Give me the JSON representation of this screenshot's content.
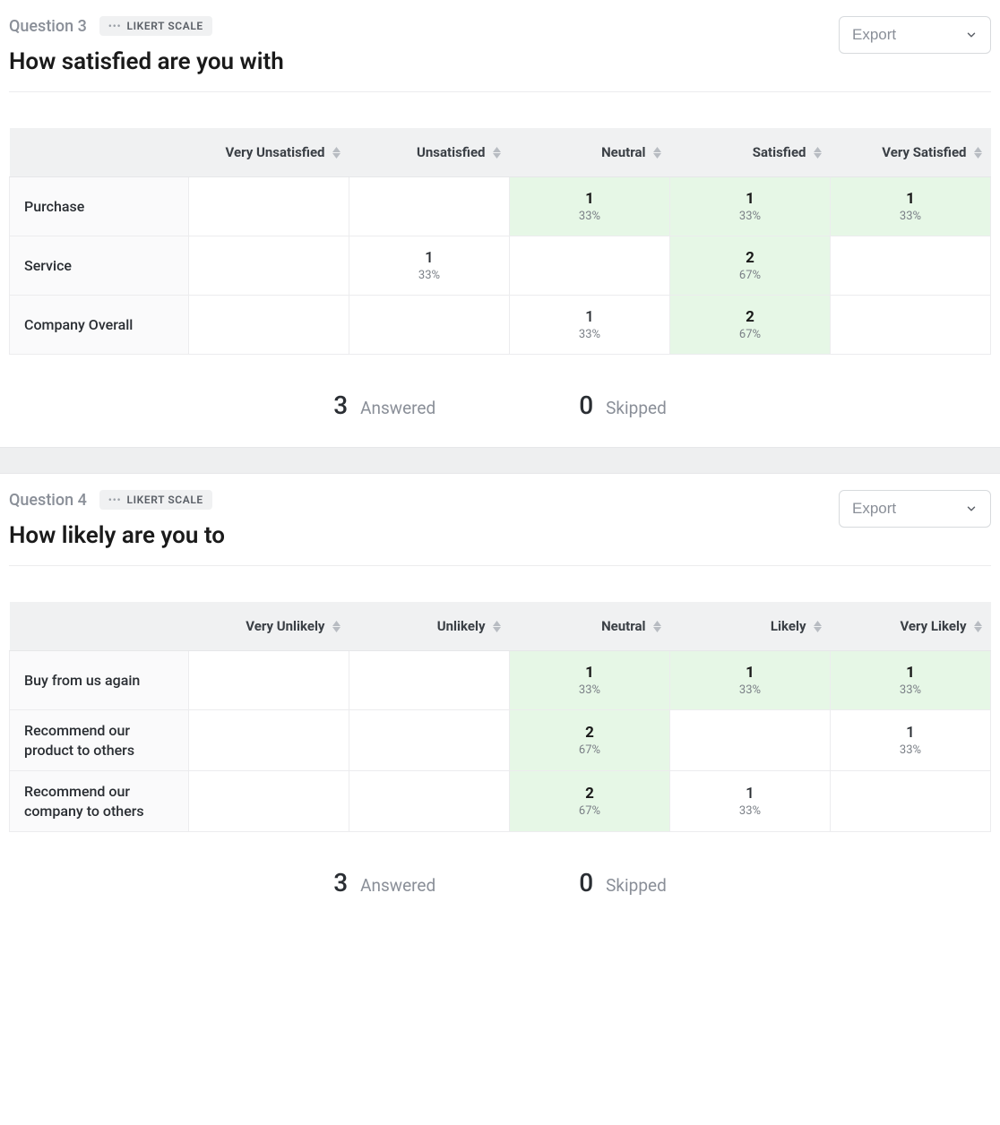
{
  "export_label": "Export",
  "answered_label": "Answered",
  "skipped_label": "Skipped",
  "questions": [
    {
      "number": "Question 3",
      "type_label": "LIKERT SCALE",
      "title": "How satisfied are you with",
      "columns": [
        "Very Unsatisfied",
        "Unsatisfied",
        "Neutral",
        "Satisfied",
        "Very Satisfied"
      ],
      "rows": [
        {
          "label": "Purchase",
          "cells": [
            null,
            null,
            {
              "count": "1",
              "pct": "33%",
              "highlight": true
            },
            {
              "count": "1",
              "pct": "33%",
              "highlight": true
            },
            {
              "count": "1",
              "pct": "33%",
              "highlight": true
            }
          ]
        },
        {
          "label": "Service",
          "cells": [
            null,
            {
              "count": "1",
              "pct": "33%",
              "highlight": false
            },
            null,
            {
              "count": "2",
              "pct": "67%",
              "highlight": true
            },
            null
          ]
        },
        {
          "label": "Company Overall",
          "cells": [
            null,
            null,
            {
              "count": "1",
              "pct": "33%",
              "highlight": false
            },
            {
              "count": "2",
              "pct": "67%",
              "highlight": true
            },
            null
          ]
        }
      ],
      "answered": "3",
      "skipped": "0"
    },
    {
      "number": "Question 4",
      "type_label": "LIKERT SCALE",
      "title": "How likely are you to",
      "columns": [
        "Very Unlikely",
        "Unlikely",
        "Neutral",
        "Likely",
        "Very Likely"
      ],
      "rows": [
        {
          "label": "Buy from us again",
          "cells": [
            null,
            null,
            {
              "count": "1",
              "pct": "33%",
              "highlight": true
            },
            {
              "count": "1",
              "pct": "33%",
              "highlight": true
            },
            {
              "count": "1",
              "pct": "33%",
              "highlight": true
            }
          ]
        },
        {
          "label": "Recommend our product to others",
          "cells": [
            null,
            null,
            {
              "count": "2",
              "pct": "67%",
              "highlight": true
            },
            null,
            {
              "count": "1",
              "pct": "33%",
              "highlight": false
            }
          ]
        },
        {
          "label": "Recommend our company to others",
          "cells": [
            null,
            null,
            {
              "count": "2",
              "pct": "67%",
              "highlight": true
            },
            {
              "count": "1",
              "pct": "33%",
              "highlight": false
            },
            null
          ]
        }
      ],
      "answered": "3",
      "skipped": "0"
    }
  ],
  "chart_data": [
    {
      "type": "table",
      "title": "How satisfied are you with",
      "columns": [
        "Very Unsatisfied",
        "Unsatisfied",
        "Neutral",
        "Satisfied",
        "Very Satisfied"
      ],
      "rows": [
        "Purchase",
        "Service",
        "Company Overall"
      ],
      "counts": [
        [
          0,
          0,
          1,
          1,
          1
        ],
        [
          0,
          1,
          0,
          2,
          0
        ],
        [
          0,
          0,
          1,
          2,
          0
        ]
      ],
      "percents": [
        [
          0,
          0,
          33,
          33,
          33
        ],
        [
          0,
          33,
          0,
          67,
          0
        ],
        [
          0,
          0,
          33,
          67,
          0
        ]
      ],
      "answered": 3,
      "skipped": 0
    },
    {
      "type": "table",
      "title": "How likely are you to",
      "columns": [
        "Very Unlikely",
        "Unlikely",
        "Neutral",
        "Likely",
        "Very Likely"
      ],
      "rows": [
        "Buy from us again",
        "Recommend our product to others",
        "Recommend our company to others"
      ],
      "counts": [
        [
          0,
          0,
          1,
          1,
          1
        ],
        [
          0,
          0,
          2,
          0,
          1
        ],
        [
          0,
          0,
          2,
          1,
          0
        ]
      ],
      "percents": [
        [
          0,
          0,
          33,
          33,
          33
        ],
        [
          0,
          0,
          67,
          0,
          33
        ],
        [
          0,
          0,
          67,
          33,
          0
        ]
      ],
      "answered": 3,
      "skipped": 0
    }
  ]
}
